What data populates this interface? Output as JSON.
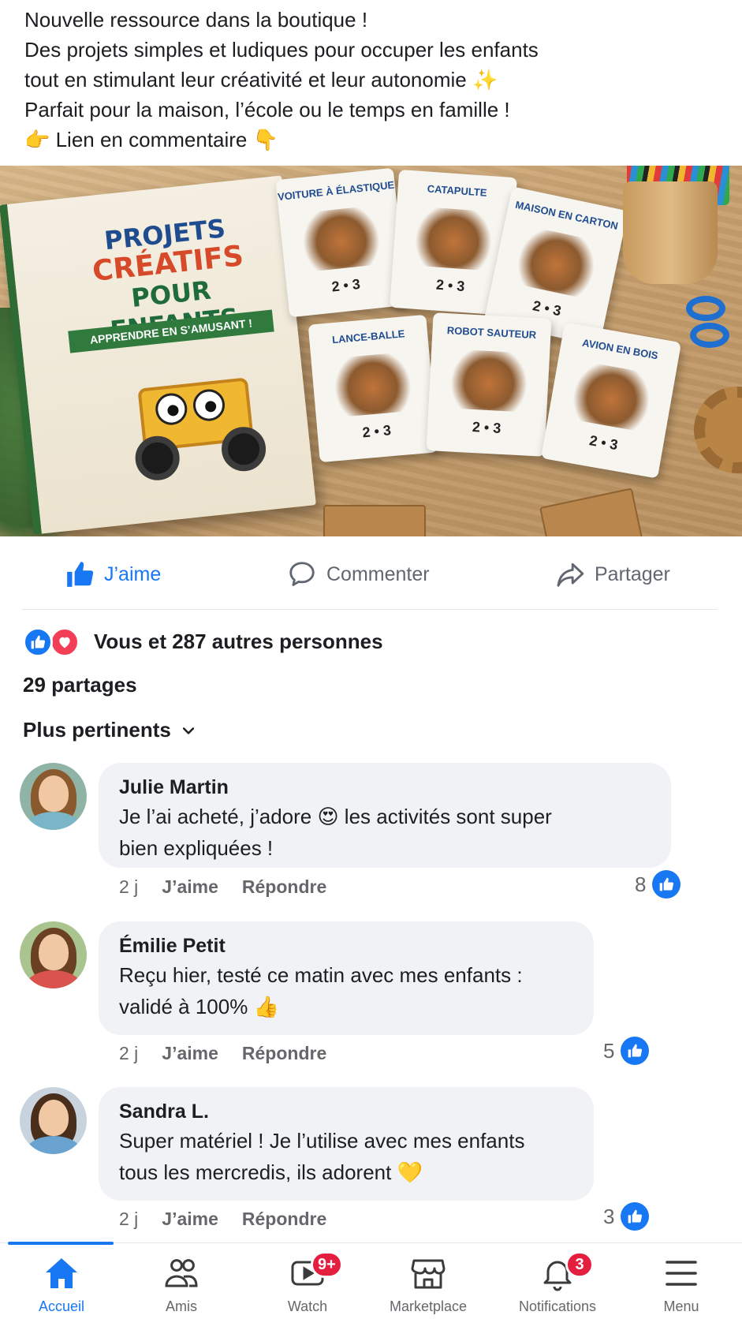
{
  "post": {
    "text_lines": [
      "Nouvelle ressource dans la boutique !",
      "Des projets simples et ludiques pour occuper les enfants",
      "tout en stimulant leur créativité et leur autonomie ✨",
      "Parfait pour la maison, l’école ou le temps en famille !",
      "👉 Lien en commentaire 👇"
    ]
  },
  "image": {
    "book": {
      "line1": "PROJETS",
      "line2": "CRÉATIFS",
      "line3": "POUR ENFANTS",
      "ribbon": "APPRENDRE EN S’AMUSANT !"
    },
    "cards": [
      {
        "title": "VOITURE À ÉLASTIQUE",
        "num": "2 • 3"
      },
      {
        "title": "CATAPULTE",
        "num": "2 • 3"
      },
      {
        "title": "MAISON EN CARTON",
        "num": "2 • 3"
      },
      {
        "title": "LANCE-BALLE",
        "num": "2 • 3"
      },
      {
        "title": "ROBOT SAUTEUR",
        "num": "2 • 3"
      },
      {
        "title": "AVION EN BOIS",
        "num": "2 • 3"
      }
    ]
  },
  "actions": {
    "like": "J’aime",
    "comment": "Commenter",
    "share": "Partager"
  },
  "stats": {
    "reactions_text": "Vous et 287 autres personnes",
    "shares_text": "29 partages",
    "sort_label": "Plus pertinents"
  },
  "comments": [
    {
      "name": "Julie Martin",
      "lines": [
        "Je l’ai acheté, j’adore 😍  les activités sont super",
        "bien expliquées !"
      ],
      "time": "2 j",
      "like_label": "J’aime",
      "reply_label": "Répondre",
      "likes": "8"
    },
    {
      "name": "Émilie Petit",
      "lines": [
        "Reçu hier, testé ce matin avec mes enfants :",
        "validé à 100% 👍"
      ],
      "time": "2 j",
      "like_label": "J’aime",
      "reply_label": "Répondre",
      "likes": "5"
    },
    {
      "name": "Sandra L.",
      "lines": [
        "Super matériel ! Je l’utilise avec mes enfants",
        "tous les mercredis, ils adorent 💛"
      ],
      "time": "2 j",
      "like_label": "J’aime",
      "reply_label": "Répondre",
      "likes": "3"
    }
  ],
  "nav": {
    "items": [
      {
        "label": "Accueil",
        "icon": "home-icon"
      },
      {
        "label": "Amis",
        "icon": "friends-icon"
      },
      {
        "label": "Watch",
        "icon": "watch-icon",
        "badge": "9+"
      },
      {
        "label": "Marketplace",
        "icon": "marketplace-icon"
      },
      {
        "label": "Notifications",
        "icon": "bell-icon",
        "badge": "3"
      },
      {
        "label": "Menu",
        "icon": "menu-icon"
      }
    ],
    "active": "Accueil"
  },
  "colors": {
    "accent": "#1877f2",
    "love": "#f33e58",
    "badge": "#e41e3f",
    "comment_bg": "#f0f2f5"
  }
}
